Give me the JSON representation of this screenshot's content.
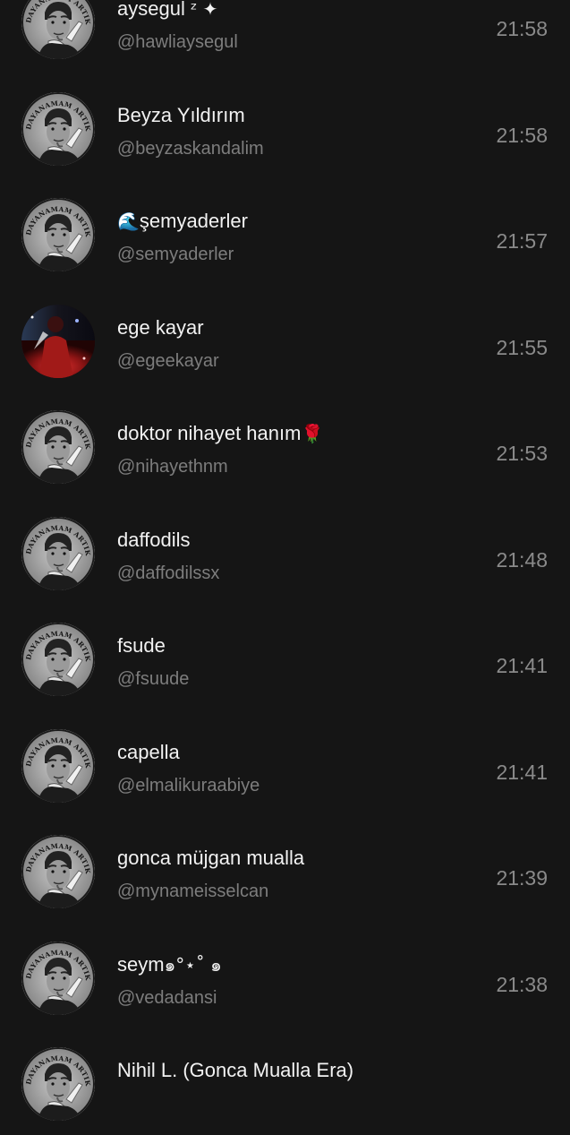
{
  "messages": [
    {
      "name": "aysegul",
      "name_emoji": "ᶻ ✦",
      "handle": "@hawliaysegul",
      "time": "21:58",
      "avatar": "dayanamam-artik-icon"
    },
    {
      "name": "Beyza Yıldırım",
      "name_emoji": "",
      "handle": "@beyzaskandalim",
      "time": "21:58",
      "avatar": "dayanamam-artik-icon"
    },
    {
      "name": "şemyaderler",
      "name_emoji": "🌊",
      "handle": "@semyaderler",
      "time": "21:57",
      "avatar": "dayanamam-artik-icon"
    },
    {
      "name": "ege kayar",
      "name_emoji": "",
      "handle": "@egeekayar",
      "time": "21:55",
      "avatar": "red-concert-photo-icon"
    },
    {
      "name": "doktor nihayet hanım",
      "name_emoji": "🌹",
      "handle": "@nihayethnm",
      "time": "21:53",
      "avatar": "dayanamam-artik-icon"
    },
    {
      "name": "daffodils",
      "name_emoji": "",
      "handle": "@daffodilssx",
      "time": "21:48",
      "avatar": "dayanamam-artik-icon"
    },
    {
      "name": "fsude",
      "name_emoji": "",
      "handle": "@fsuude",
      "time": "21:41",
      "avatar": "dayanamam-artik-icon"
    },
    {
      "name": "capella",
      "name_emoji": "",
      "handle": "@elmalikuraabiye",
      "time": "21:41",
      "avatar": "dayanamam-artik-icon"
    },
    {
      "name": "gonca müjgan mualla",
      "name_emoji": "",
      "handle": "@mynameisselcan",
      "time": "21:39",
      "avatar": "dayanamam-artik-icon"
    },
    {
      "name": "seym",
      "name_emoji": "๑°⋆˚ ๑",
      "handle": "@vedadansi",
      "time": "21:38",
      "avatar": "dayanamam-artik-icon"
    },
    {
      "name": "Nihil L. (Gonca Mualla Era)",
      "name_emoji": "",
      "handle": "",
      "time": "",
      "avatar": "dayanamam-artik-icon"
    }
  ],
  "avatar_text": "DAYANAMAM ARTIK",
  "colors": {
    "background": "#151515",
    "name": "#f2f2f2",
    "handle": "#7d7d7d",
    "time": "#8a8a8a"
  }
}
